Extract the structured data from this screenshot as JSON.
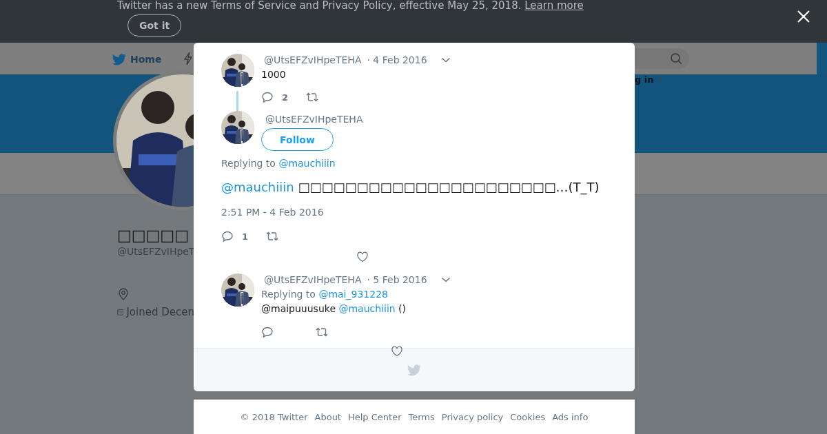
{
  "banner": {
    "text": "Twitter has a new Terms of Service and Privacy Policy, effective May 25, 2018.",
    "link": "Learn more",
    "button": "Got it"
  },
  "nav": {
    "home": "Home",
    "login": "g in"
  },
  "profile": {
    "name": "□□□□□",
    "handle": "@UtsEFZvIHpeT",
    "joined": "Joined Decen"
  },
  "thread": [
    {
      "kind": "parent",
      "handle": "@UtsEFZvIHpeTEHA",
      "date": "· 4 Feb 2016",
      "body": [
        {
          "text": "1000",
          "link": false
        }
      ],
      "replies": "2"
    },
    {
      "kind": "focus",
      "handle": "@UtsEFZvIHpeTEHA",
      "follow": "Follow",
      "replying_label": "Replying to",
      "replying_to": "@mauchiiin",
      "body": [
        {
          "text": "@mauchiiin",
          "link": true
        },
        {
          "text": " □□□□□□□□□□□□□□□□□□□□□□…(T_T)",
          "link": false
        }
      ],
      "time": "2:51 PM - 4 Feb 2016",
      "replies": "1"
    },
    {
      "kind": "reply",
      "handle": "@UtsEFZvIHpeTEHA",
      "date": "· 5 Feb 2016",
      "replying_label": "Replying to",
      "replying_to": "@mai_931228",
      "body": [
        {
          "text": "@maipuuusuke ",
          "link": false
        },
        {
          "text": "@mauchiiin",
          "link": true
        },
        {
          "text": " ()",
          "link": false
        }
      ]
    }
  ],
  "footer": [
    "© 2018 Twitter",
    "About",
    "Help Center",
    "Terms",
    "Privacy policy",
    "Cookies",
    "Ads info"
  ]
}
